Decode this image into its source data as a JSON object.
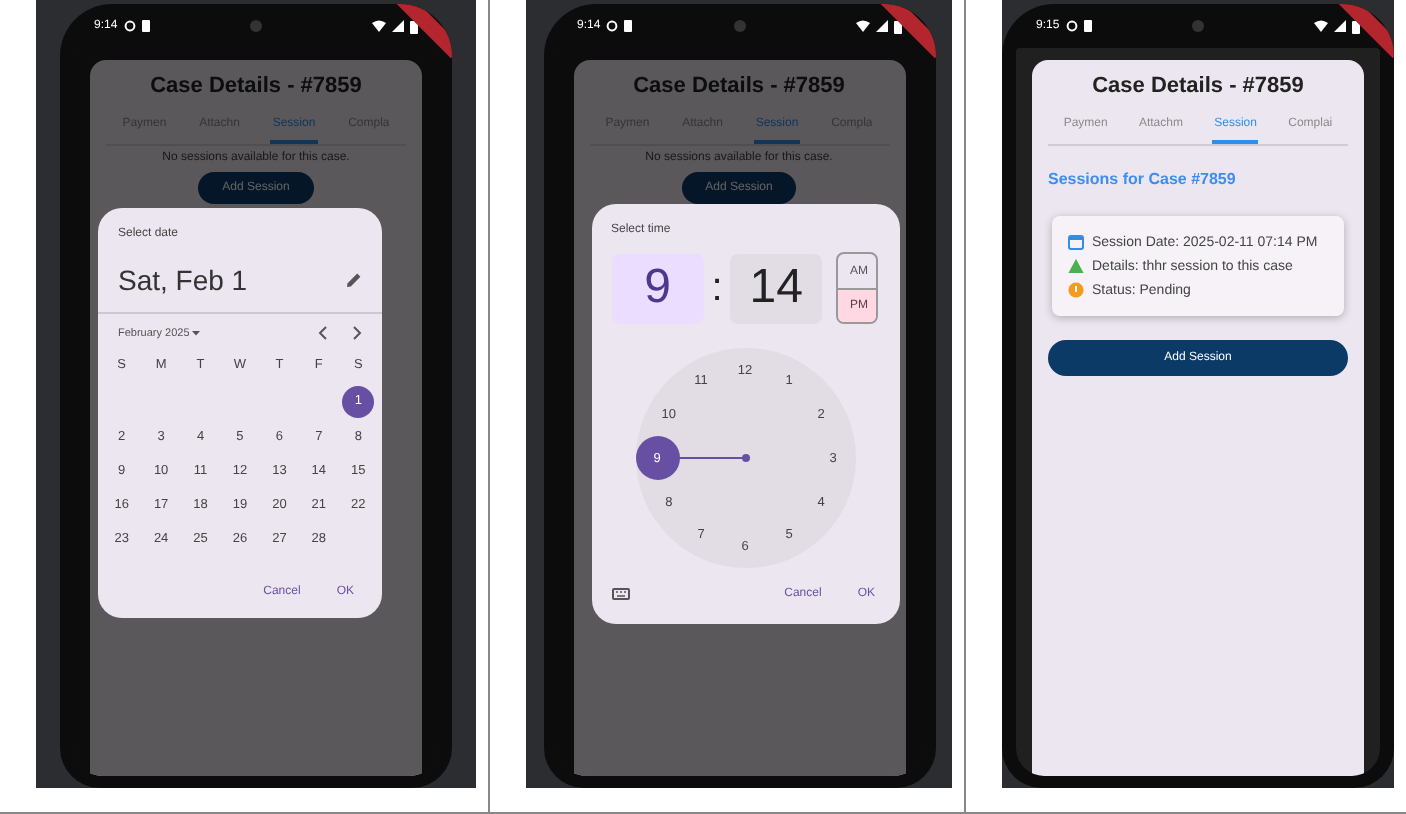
{
  "panels": [
    {
      "kind": "date",
      "scrim": true,
      "status_time": "9:14",
      "card": {
        "title": "Case Details - #7859",
        "tabs": [
          {
            "label": "Paymen",
            "selected": false
          },
          {
            "label": "Attachn",
            "selected": false
          },
          {
            "label": "Session",
            "selected": true
          },
          {
            "label": "Compla",
            "selected": false
          }
        ],
        "empty_text": "No sessions available for this case.",
        "add_button": "Add Session"
      },
      "dialog": {
        "heading": "Select date",
        "date": "Sat, Feb 1",
        "month": "February 2025",
        "weekdays": [
          "S",
          "M",
          "T",
          "W",
          "T",
          "F",
          "S"
        ],
        "weeks": [
          [
            {
              "label": "1",
              "selected": true
            }
          ],
          [
            {
              "label": "2",
              "selected": false
            },
            {
              "label": "3",
              "selected": false
            },
            {
              "label": "4",
              "selected": false
            },
            {
              "label": "5",
              "selected": false
            },
            {
              "label": "6",
              "selected": false
            },
            {
              "label": "7",
              "selected": false
            },
            {
              "label": "8",
              "selected": false
            }
          ],
          [
            {
              "label": "9",
              "selected": false
            },
            {
              "label": "10",
              "selected": false
            },
            {
              "label": "11",
              "selected": false
            },
            {
              "label": "12",
              "selected": false
            },
            {
              "label": "13",
              "selected": false
            },
            {
              "label": "14",
              "selected": false
            },
            {
              "label": "15",
              "selected": false
            }
          ],
          [
            {
              "label": "16",
              "selected": false
            },
            {
              "label": "17",
              "selected": false
            },
            {
              "label": "18",
              "selected": false
            },
            {
              "label": "19",
              "selected": false
            },
            {
              "label": "20",
              "selected": false
            },
            {
              "label": "21",
              "selected": false
            },
            {
              "label": "22",
              "selected": false
            }
          ],
          [
            {
              "label": "23",
              "selected": false
            },
            {
              "label": "24",
              "selected": false
            },
            {
              "label": "25",
              "selected": false
            },
            {
              "label": "26",
              "selected": false
            },
            {
              "label": "27",
              "selected": false
            },
            {
              "label": "28",
              "selected": false
            }
          ]
        ],
        "buttons": [
          "Cancel",
          "OK"
        ]
      }
    },
    {
      "kind": "time",
      "scrim": true,
      "status_time": "9:14",
      "card": {
        "title": "Case Details - #7859",
        "tabs": [
          {
            "label": "Paymen",
            "selected": false
          },
          {
            "label": "Attachn",
            "selected": false
          },
          {
            "label": "Session",
            "selected": true
          },
          {
            "label": "Compla",
            "selected": false
          }
        ],
        "empty_text": "No sessions available for this case.",
        "add_button": "Add Session"
      },
      "dialog": {
        "heading": "Select time",
        "fields": [
          {
            "value": "9",
            "selected": true
          },
          {
            "value": "14",
            "selected": false
          }
        ],
        "separator": ":",
        "periods": [
          {
            "label": "AM",
            "selected": false
          },
          {
            "label": "PM",
            "selected": true
          }
        ],
        "clock": [
          {
            "label": "12",
            "selected": false
          },
          {
            "label": "1",
            "selected": false
          },
          {
            "label": "2",
            "selected": false
          },
          {
            "label": "3",
            "selected": false
          },
          {
            "label": "4",
            "selected": false
          },
          {
            "label": "5",
            "selected": false
          },
          {
            "label": "6",
            "selected": false
          },
          {
            "label": "7",
            "selected": false
          },
          {
            "label": "8",
            "selected": false
          },
          {
            "label": "9",
            "selected": true
          },
          {
            "label": "10",
            "selected": false
          },
          {
            "label": "11",
            "selected": false
          }
        ],
        "buttons": [
          "Cancel",
          "OK"
        ]
      }
    },
    {
      "kind": "sessions",
      "scrim": false,
      "status_time": "9:15",
      "card": {
        "title": "Case Details - #7859",
        "tabs": [
          {
            "label": "Paymen",
            "selected": false
          },
          {
            "label": "Attachm",
            "selected": false
          },
          {
            "label": "Session",
            "selected": true
          },
          {
            "label": "Complai",
            "selected": false
          }
        ],
        "heading": "Sessions for Case #7859",
        "session": [
          {
            "kind": "date",
            "text": "Session Date: 2025-02-11 07:14 PM"
          },
          {
            "kind": "details",
            "text": "Details: thhr session to this case"
          },
          {
            "kind": "status",
            "text": "Status: Pending"
          }
        ],
        "add_button": "Add Session"
      }
    }
  ]
}
